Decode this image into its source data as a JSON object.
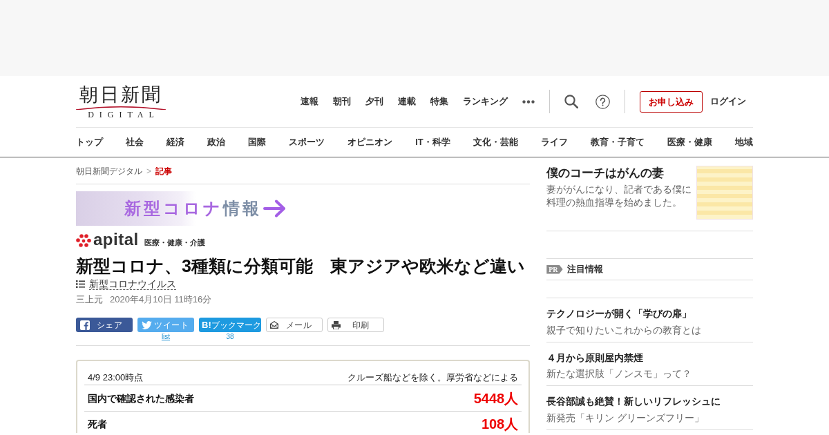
{
  "header": {
    "logo": {
      "title": "朝日新聞",
      "subtitle": "DIGITAL"
    },
    "nav": [
      "速報",
      "朝刊",
      "夕刊",
      "連載",
      "特集",
      "ランキング"
    ],
    "subscribe_button": "お申し込み",
    "login_link": "ログイン"
  },
  "categories": [
    "トップ",
    "社会",
    "経済",
    "政治",
    "国際",
    "スポーツ",
    "オピニオン",
    "IT・科学",
    "文化・芸能",
    "ライフ",
    "教育・子育て",
    "医療・健康",
    "地域"
  ],
  "breadcrumb": {
    "separator": ">",
    "items": [
      {
        "label": "朝日新聞デジタル",
        "current": false
      },
      {
        "label": "記事",
        "current": true
      }
    ]
  },
  "article": {
    "banner": [
      "新型コロナ",
      "情報"
    ],
    "section": {
      "name": "apital",
      "tagline": "医療・健康・介護"
    },
    "headline": "新型コロナ、3種類に分類可能　東アジアや欧米など違い",
    "topic": "新型コロナウイルス",
    "author": "三上元",
    "published": "2020年4月10日 11時16分",
    "share_buttons": [
      {
        "kind": "facebook",
        "label": "シェア"
      },
      {
        "kind": "twitter",
        "label": "ツイート",
        "below": "list"
      },
      {
        "kind": "hatena",
        "label": "**B!**ブックマーク",
        "below": "38"
      },
      {
        "kind": "mail",
        "label": "メール"
      },
      {
        "kind": "print",
        "label": "印刷"
      }
    ],
    "stats": {
      "as_of": "4/9 23:00時点",
      "note": "クルーズ船などを除く。厚労省などによる",
      "rows": [
        {
          "label": "国内で確認された感染者",
          "value": "5448人"
        },
        {
          "label": "死者",
          "value": "108人"
        }
      ]
    }
  },
  "sidebar": {
    "promo": {
      "title": "僕のコーチはがんの妻",
      "description": "妻ががんになり、記者である僕に料理の熱血指導を始めました。"
    },
    "pr": {
      "badge": "PR",
      "title": "注目情報",
      "items": [
        {
          "title": "テクノロジーが開く「学びの扉」",
          "subtitle": "親子で知りたいこれからの教育とは"
        },
        {
          "title": "４月から原則屋内禁煙",
          "subtitle": "新たな選択肢「ノンスモ」って？"
        },
        {
          "title": "長谷部誠も絶賛！新しいリフレッシュに",
          "subtitle": "新発売「キリン グリーンズフリー」"
        }
      ]
    }
  }
}
